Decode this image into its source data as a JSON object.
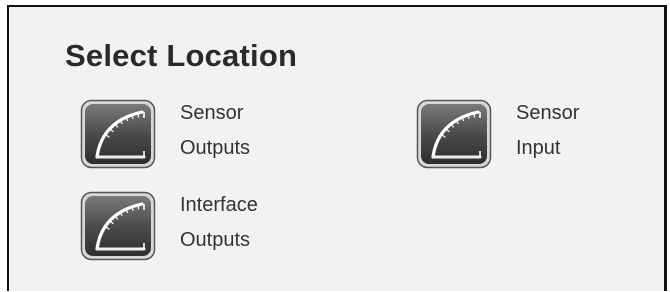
{
  "dialog": {
    "title": "Select Location",
    "options": [
      {
        "line1": "Sensor",
        "line2": "Outputs",
        "icon": "gauge-icon"
      },
      {
        "line1": "Sensor",
        "line2": "Input",
        "icon": "gauge-icon"
      },
      {
        "line1": "Interface",
        "line2": "Outputs",
        "icon": "gauge-icon"
      }
    ]
  },
  "colors": {
    "frame_border": "#111111",
    "panel_background": "#f2f2f2",
    "icon_dark": "#4a4a4a",
    "text": "#333333"
  }
}
